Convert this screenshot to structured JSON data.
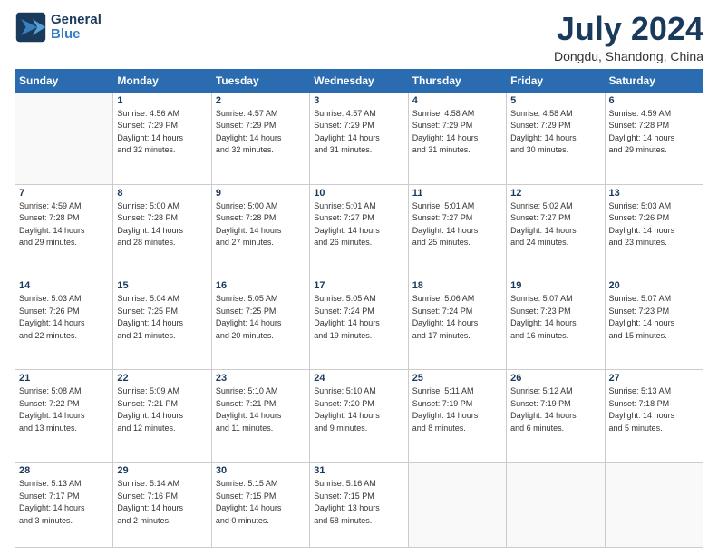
{
  "header": {
    "logo_line1": "General",
    "logo_line2": "Blue",
    "month_title": "July 2024",
    "location": "Dongdu, Shandong, China"
  },
  "days_of_week": [
    "Sunday",
    "Monday",
    "Tuesday",
    "Wednesday",
    "Thursday",
    "Friday",
    "Saturday"
  ],
  "weeks": [
    [
      {
        "day": "",
        "info": ""
      },
      {
        "day": "1",
        "info": "Sunrise: 4:56 AM\nSunset: 7:29 PM\nDaylight: 14 hours\nand 32 minutes."
      },
      {
        "day": "2",
        "info": "Sunrise: 4:57 AM\nSunset: 7:29 PM\nDaylight: 14 hours\nand 32 minutes."
      },
      {
        "day": "3",
        "info": "Sunrise: 4:57 AM\nSunset: 7:29 PM\nDaylight: 14 hours\nand 31 minutes."
      },
      {
        "day": "4",
        "info": "Sunrise: 4:58 AM\nSunset: 7:29 PM\nDaylight: 14 hours\nand 31 minutes."
      },
      {
        "day": "5",
        "info": "Sunrise: 4:58 AM\nSunset: 7:29 PM\nDaylight: 14 hours\nand 30 minutes."
      },
      {
        "day": "6",
        "info": "Sunrise: 4:59 AM\nSunset: 7:28 PM\nDaylight: 14 hours\nand 29 minutes."
      }
    ],
    [
      {
        "day": "7",
        "info": "Sunrise: 4:59 AM\nSunset: 7:28 PM\nDaylight: 14 hours\nand 29 minutes."
      },
      {
        "day": "8",
        "info": "Sunrise: 5:00 AM\nSunset: 7:28 PM\nDaylight: 14 hours\nand 28 minutes."
      },
      {
        "day": "9",
        "info": "Sunrise: 5:00 AM\nSunset: 7:28 PM\nDaylight: 14 hours\nand 27 minutes."
      },
      {
        "day": "10",
        "info": "Sunrise: 5:01 AM\nSunset: 7:27 PM\nDaylight: 14 hours\nand 26 minutes."
      },
      {
        "day": "11",
        "info": "Sunrise: 5:01 AM\nSunset: 7:27 PM\nDaylight: 14 hours\nand 25 minutes."
      },
      {
        "day": "12",
        "info": "Sunrise: 5:02 AM\nSunset: 7:27 PM\nDaylight: 14 hours\nand 24 minutes."
      },
      {
        "day": "13",
        "info": "Sunrise: 5:03 AM\nSunset: 7:26 PM\nDaylight: 14 hours\nand 23 minutes."
      }
    ],
    [
      {
        "day": "14",
        "info": "Sunrise: 5:03 AM\nSunset: 7:26 PM\nDaylight: 14 hours\nand 22 minutes."
      },
      {
        "day": "15",
        "info": "Sunrise: 5:04 AM\nSunset: 7:25 PM\nDaylight: 14 hours\nand 21 minutes."
      },
      {
        "day": "16",
        "info": "Sunrise: 5:05 AM\nSunset: 7:25 PM\nDaylight: 14 hours\nand 20 minutes."
      },
      {
        "day": "17",
        "info": "Sunrise: 5:05 AM\nSunset: 7:24 PM\nDaylight: 14 hours\nand 19 minutes."
      },
      {
        "day": "18",
        "info": "Sunrise: 5:06 AM\nSunset: 7:24 PM\nDaylight: 14 hours\nand 17 minutes."
      },
      {
        "day": "19",
        "info": "Sunrise: 5:07 AM\nSunset: 7:23 PM\nDaylight: 14 hours\nand 16 minutes."
      },
      {
        "day": "20",
        "info": "Sunrise: 5:07 AM\nSunset: 7:23 PM\nDaylight: 14 hours\nand 15 minutes."
      }
    ],
    [
      {
        "day": "21",
        "info": "Sunrise: 5:08 AM\nSunset: 7:22 PM\nDaylight: 14 hours\nand 13 minutes."
      },
      {
        "day": "22",
        "info": "Sunrise: 5:09 AM\nSunset: 7:21 PM\nDaylight: 14 hours\nand 12 minutes."
      },
      {
        "day": "23",
        "info": "Sunrise: 5:10 AM\nSunset: 7:21 PM\nDaylight: 14 hours\nand 11 minutes."
      },
      {
        "day": "24",
        "info": "Sunrise: 5:10 AM\nSunset: 7:20 PM\nDaylight: 14 hours\nand 9 minutes."
      },
      {
        "day": "25",
        "info": "Sunrise: 5:11 AM\nSunset: 7:19 PM\nDaylight: 14 hours\nand 8 minutes."
      },
      {
        "day": "26",
        "info": "Sunrise: 5:12 AM\nSunset: 7:19 PM\nDaylight: 14 hours\nand 6 minutes."
      },
      {
        "day": "27",
        "info": "Sunrise: 5:13 AM\nSunset: 7:18 PM\nDaylight: 14 hours\nand 5 minutes."
      }
    ],
    [
      {
        "day": "28",
        "info": "Sunrise: 5:13 AM\nSunset: 7:17 PM\nDaylight: 14 hours\nand 3 minutes."
      },
      {
        "day": "29",
        "info": "Sunrise: 5:14 AM\nSunset: 7:16 PM\nDaylight: 14 hours\nand 2 minutes."
      },
      {
        "day": "30",
        "info": "Sunrise: 5:15 AM\nSunset: 7:15 PM\nDaylight: 14 hours\nand 0 minutes."
      },
      {
        "day": "31",
        "info": "Sunrise: 5:16 AM\nSunset: 7:15 PM\nDaylight: 13 hours\nand 58 minutes."
      },
      {
        "day": "",
        "info": ""
      },
      {
        "day": "",
        "info": ""
      },
      {
        "day": "",
        "info": ""
      }
    ]
  ]
}
